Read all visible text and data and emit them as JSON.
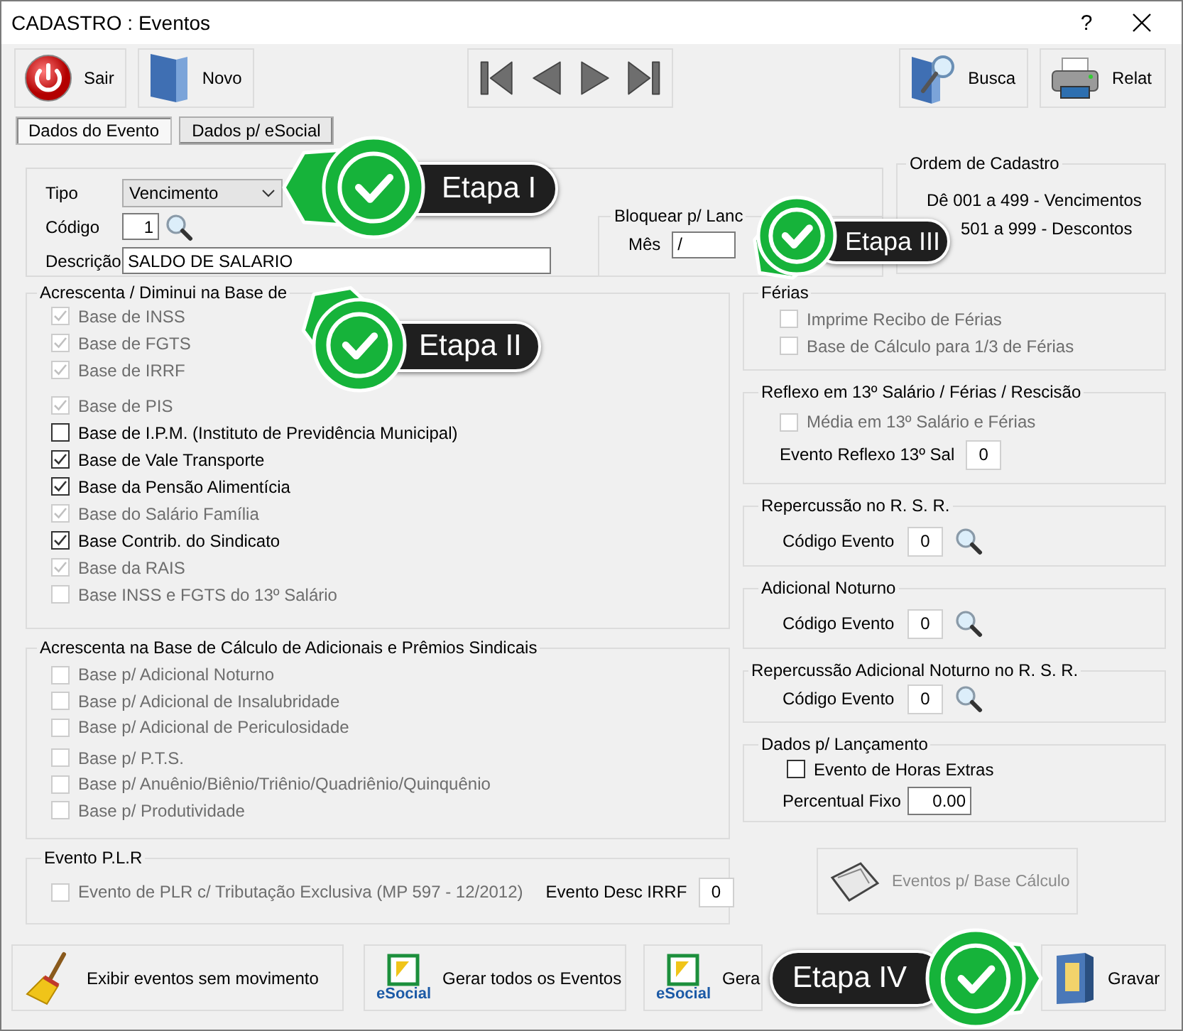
{
  "window": {
    "title": "CADASTRO : Eventos",
    "help": "?"
  },
  "toolbar": {
    "left": [
      {
        "label": "Sair"
      },
      {
        "label": "Novo"
      }
    ],
    "right": [
      {
        "label": "Busca"
      },
      {
        "label": "Relat"
      }
    ]
  },
  "tabs": [
    {
      "label": "Dados do Evento",
      "selected": true
    },
    {
      "label": "Dados p/ eSocial",
      "selected": false
    }
  ],
  "form": {
    "tipo": {
      "label": "Tipo",
      "value": "Vencimento"
    },
    "codigo": {
      "label": "Código",
      "value": "1"
    },
    "descricao": {
      "label": "Descrição",
      "value": "SALDO DE SALARIO"
    }
  },
  "bloquear": {
    "title": "Bloquear p/ Lanc",
    "label": "Mês",
    "value": "/"
  },
  "ordem": {
    "title": "Ordem de Cadastro",
    "lines": [
      "Dê 001 a 499 - Vencimentos",
      "501 a 999 - Descontos"
    ]
  },
  "bases": {
    "title": "Acrescenta / Diminui na Base de",
    "groups": [
      [
        {
          "label": "Base de INSS",
          "checked": true,
          "disabled": true
        },
        {
          "label": "Base de FGTS",
          "checked": true,
          "disabled": true
        },
        {
          "label": "Base de IRRF",
          "checked": true,
          "disabled": true
        }
      ],
      [
        {
          "label": "Base de PIS",
          "checked": true,
          "disabled": true
        },
        {
          "label": "Base de I.P.M. (Instituto de Previdência Municipal)",
          "checked": false,
          "disabled": false
        },
        {
          "label": "Base de Vale Transporte",
          "checked": true,
          "disabled": false
        },
        {
          "label": "Base da Pensão Alimentícia",
          "checked": true,
          "disabled": false
        },
        {
          "label": "Base do Salário Família",
          "checked": true,
          "disabled": true
        },
        {
          "label": "Base Contrib. do Sindicato",
          "checked": true,
          "disabled": false
        },
        {
          "label": "Base da RAIS",
          "checked": true,
          "disabled": true
        },
        {
          "label": "Base INSS e FGTS do 13º Salário",
          "checked": false,
          "disabled": true
        }
      ]
    ]
  },
  "adicionais": {
    "title": "Acrescenta na Base de Cálculo de Adicionais e Prêmios Sindicais",
    "groups": [
      [
        {
          "label": "Base p/ Adicional Noturno",
          "checked": false,
          "disabled": true
        },
        {
          "label": "Base p/ Adicional de Insalubridade",
          "checked": false,
          "disabled": true
        },
        {
          "label": "Base p/ Adicional de Periculosidade",
          "checked": false,
          "disabled": true
        }
      ],
      [
        {
          "label": "Base p/ P.T.S.",
          "checked": false,
          "disabled": true
        },
        {
          "label": "Base p/ Anuênio/Biênio/Triênio/Quadriênio/Quinquênio",
          "checked": false,
          "disabled": true
        },
        {
          "label": "Base p/ Produtividade",
          "checked": false,
          "disabled": true
        }
      ]
    ]
  },
  "plr": {
    "title": "Evento P.L.R",
    "option": {
      "label": "Evento de PLR c/ Tributação Exclusiva (MP 597 - 12/2012)",
      "checked": false,
      "disabled": true
    },
    "field_label": "Evento Desc IRRF",
    "field_value": "0"
  },
  "ferias": {
    "title": "Férias",
    "options": [
      {
        "label": "Imprime Recibo de Férias",
        "checked": false,
        "disabled": true
      },
      {
        "label": "Base de Cálculo para 1/3 de Férias",
        "checked": false,
        "disabled": true
      }
    ]
  },
  "reflexo": {
    "title": "Reflexo em 13º Salário / Férias / Rescisão",
    "option": {
      "label": "Média em 13º Salário e Férias",
      "checked": false,
      "disabled": true
    },
    "field_label": "Evento Reflexo 13º Sal",
    "field_value": "0"
  },
  "codigos": [
    {
      "title": "Repercussão no R. S. R.",
      "field_label": "Código Evento",
      "field_value": "0"
    },
    {
      "title": "Adicional Noturno",
      "field_label": "Código Evento",
      "field_value": "0"
    },
    {
      "title": "Repercussão Adicional Noturno no R. S. R.",
      "field_label": "Código Evento",
      "field_value": "0"
    }
  ],
  "lancamento": {
    "title": "Dados p/ Lançamento",
    "option": {
      "label": "Evento de Horas Extras",
      "checked": false,
      "disabled": false
    },
    "field_label": "Percentual Fixo",
    "field_value": "0.00"
  },
  "base_calculo_button": {
    "label": "Eventos p/ Base Cálculo",
    "disabled": true
  },
  "bottom_buttons": [
    {
      "label": "Exibir eventos sem movimento"
    },
    {
      "label": "Gerar todos os Eventos",
      "icon_text": "eSocial"
    },
    {
      "label": "Gera",
      "icon_text": "eSocial"
    },
    {
      "label": "Gravar"
    }
  ],
  "callouts": [
    {
      "label": "Etapa I"
    },
    {
      "label": "Etapa II"
    },
    {
      "label": "Etapa III"
    },
    {
      "label": "Etapa IV"
    }
  ]
}
